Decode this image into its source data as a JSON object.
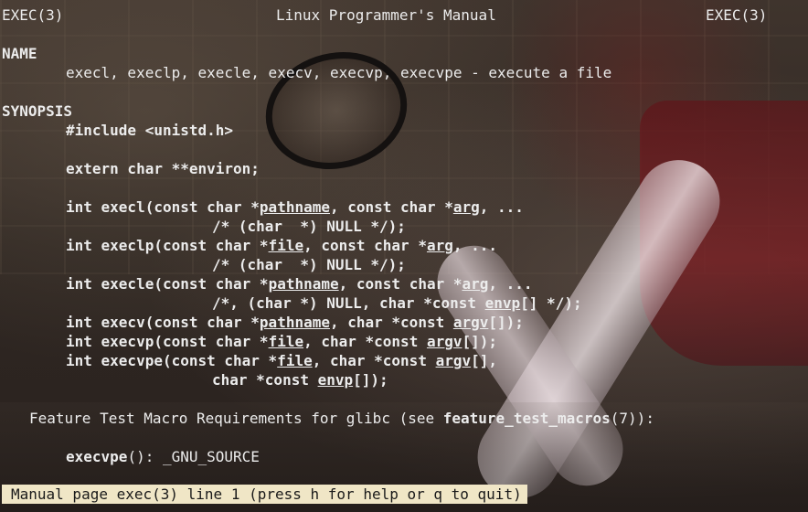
{
  "header": {
    "left": "EXEC(3)",
    "center": "Linux Programmer's Manual",
    "right": "EXEC(3)"
  },
  "sections": {
    "name_heading": "NAME",
    "name_desc": "execl, execlp, execle, execv, execvp, execvpe - execute a file",
    "synopsis_heading": "SYNOPSIS"
  },
  "synopsis": {
    "include": "#include <unistd.h>",
    "extern": "extern char **environ;",
    "execl": {
      "prefix": "int execl(const char *",
      "p1": "pathname",
      "mid": ", const char *",
      "p2": "arg",
      "end": ", ...",
      "cont": "/* (char  *) NULL */);"
    },
    "execlp": {
      "prefix": "int execlp(const char *",
      "p1": "file",
      "mid": ", const char *",
      "p2": "arg",
      "end": ", ...",
      "cont": "/* (char  *) NULL */);"
    },
    "execle": {
      "prefix": "int execle(const char *",
      "p1": "pathname",
      "mid": ", const char *",
      "p2": "arg",
      "end": ", ...",
      "cont_prefix": "/*, (char *) NULL, char *const ",
      "cont_param": "envp",
      "cont_end": "[] */);"
    },
    "execv": {
      "prefix": "int execv(const char *",
      "p1": "pathname",
      "mid": ", char *const ",
      "p2": "argv",
      "end": "[]);"
    },
    "execvp": {
      "prefix": "int execvp(const char *",
      "p1": "file",
      "mid": ", char *const ",
      "p2": "argv",
      "end": "[]);"
    },
    "execvpe": {
      "prefix": "int execvpe(const char *",
      "p1": "file",
      "mid": ", char *const ",
      "p2": "argv",
      "end": "[],",
      "cont_prefix": "char *const ",
      "cont_param": "envp",
      "cont_end": "[]);"
    }
  },
  "feature": {
    "prefix": "Feature Test Macro Requirements for glibc (see ",
    "link": "feature_test_macros",
    "suffix": "(7)):",
    "func": "execvpe",
    "func_suffix": "(): _GNU_SOURCE"
  },
  "status_bar": {
    "text": "Manual page exec(3) line 1 (press h for help or q to quit)"
  },
  "colors": {
    "text": "#ececec",
    "status_bg": "#f0e6c6",
    "status_fg": "#1a1a1a"
  }
}
